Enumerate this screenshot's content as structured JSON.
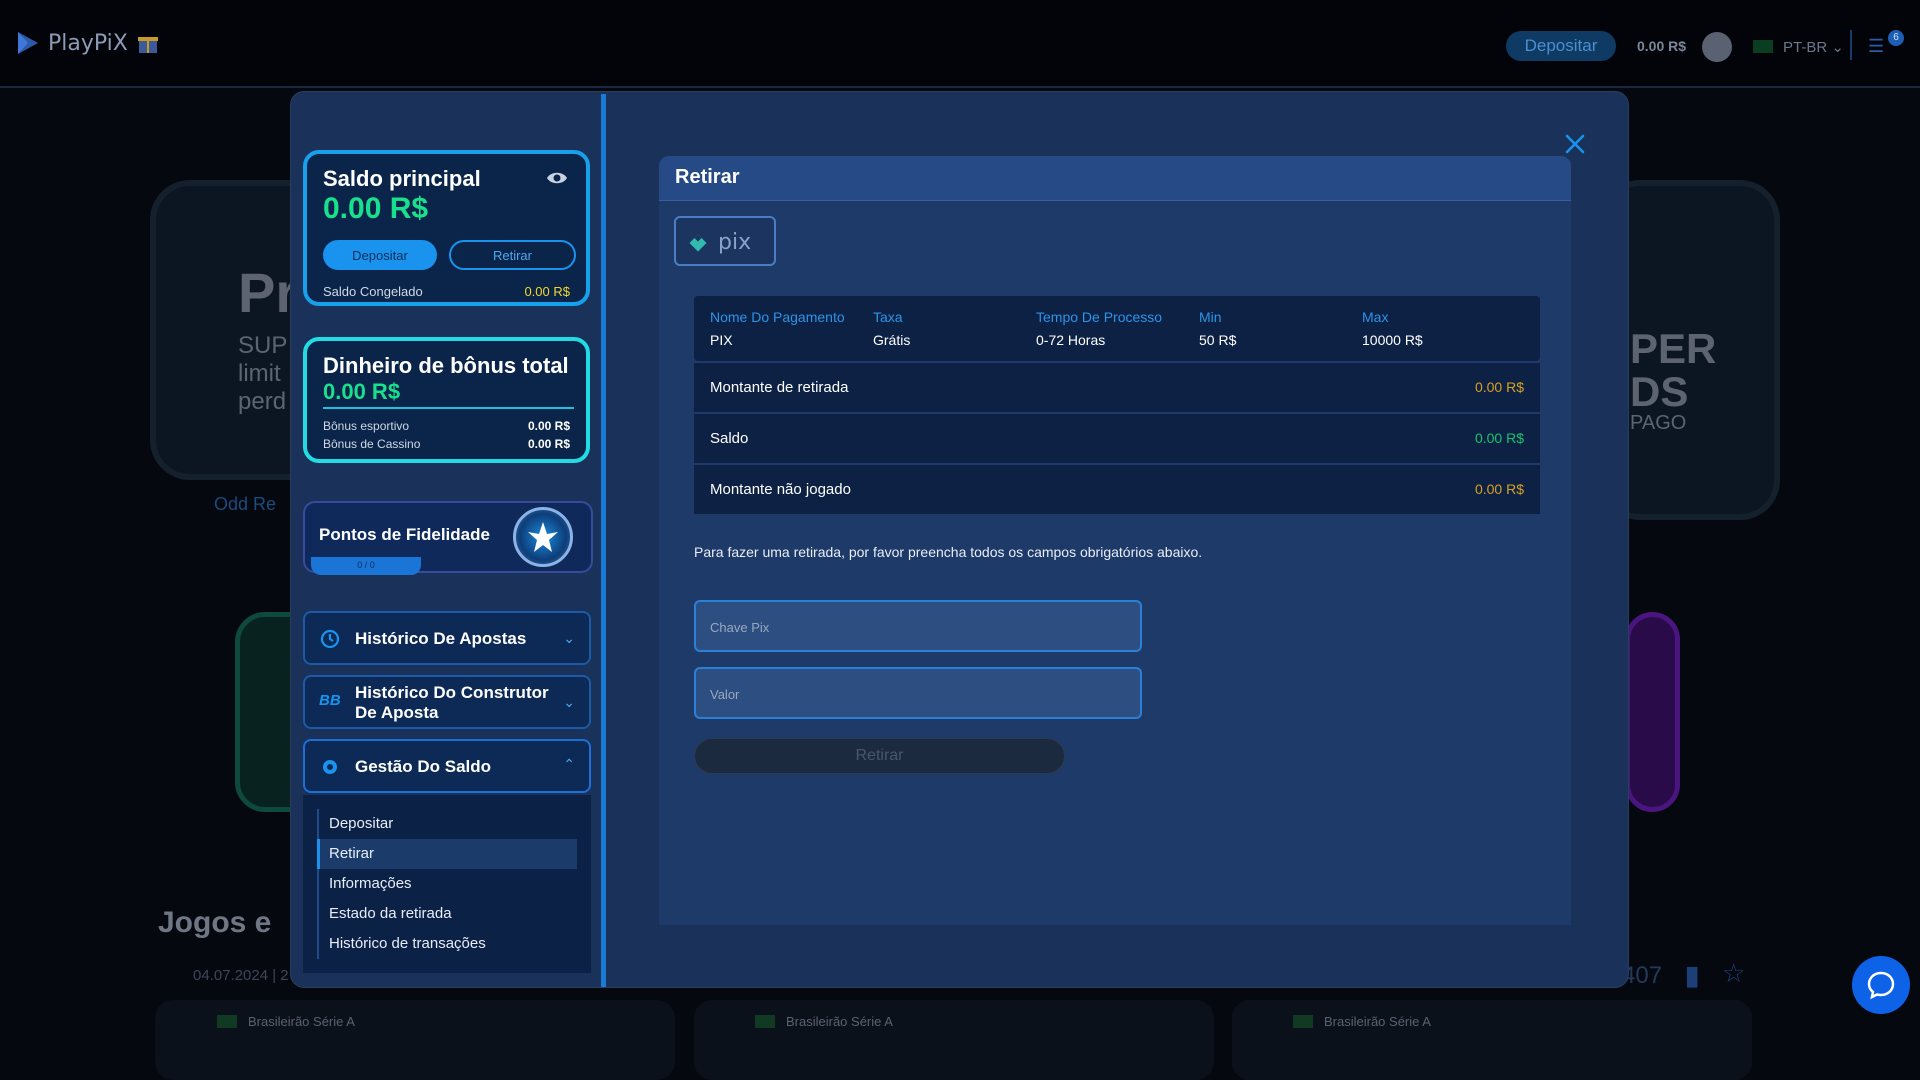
{
  "header": {
    "logo_text": "PlayPiX",
    "deposit_label": "Depositar",
    "balance": "0.00 R$",
    "language": "PT-BR",
    "notification_count": "6"
  },
  "background": {
    "section_title": "Jogos e",
    "date_text": "04.07.2024 | 2",
    "match_league": [
      "Brasileirão Série A",
      "Brasileirão Série A",
      "Brasileirão Série A"
    ],
    "banner_left": [
      "Pr",
      "SUP",
      "limit",
      "perd",
      "Odd Re"
    ],
    "banner_right": [
      "PER",
      "DS",
      "PAGO"
    ],
    "right_count": "407"
  },
  "modal": {
    "saldo": {
      "title": "Saldo principal",
      "amount": "0.00 R$",
      "deposit_label": "Depositar",
      "withdraw_label": "Retirar",
      "frozen_label": "Saldo Congelado",
      "frozen_value": "0.00 R$"
    },
    "bonus": {
      "title": "Dinheiro de bônus total",
      "amount": "0.00 R$",
      "sports_label": "Bônus esportivo",
      "sports_value": "0.00 R$",
      "casino_label": "Bônus de Cassino",
      "casino_value": "0.00 R$"
    },
    "loyalty": {
      "title": "Pontos de Fidelidade",
      "progress": "0 / 0"
    },
    "accordion": [
      {
        "label": "Histórico De Apostas"
      },
      {
        "label": "Histórico Do Construtor De Aposta"
      },
      {
        "label": "Gestão Do Saldo"
      }
    ],
    "submenu": [
      "Depositar",
      "Retirar",
      "Informações",
      "Estado da retirada",
      "Histórico de transações"
    ],
    "submenu_active": "Retirar",
    "panel": {
      "title": "Retirar",
      "method_logo": "pix",
      "table_headers": [
        "Nome Do Pagamento",
        "Taxa",
        "Tempo De Processo",
        "Min",
        "Max"
      ],
      "table_values": [
        "PIX",
        "Grátis",
        "0-72 Horas",
        "50 R$",
        "10000 R$"
      ],
      "rows": [
        {
          "label": "Montante de retirada",
          "value": "0.00 R$",
          "color": "#d9a021"
        },
        {
          "label": "Saldo",
          "value": "0.00 R$",
          "color": "#17c46a"
        },
        {
          "label": "Montante não jogado",
          "value": "0.00 R$",
          "color": "#d9a021"
        }
      ],
      "instructions": "Para fazer uma retirada, por favor preencha todos os campos obrigatórios abaixo.",
      "pix_key_placeholder": "Chave Pix",
      "value_placeholder": "Valor",
      "submit_label": "Retirar"
    }
  },
  "colors": {
    "accent": "#1993ee",
    "money_green": "#19e08d",
    "gold": "#d9a021"
  }
}
